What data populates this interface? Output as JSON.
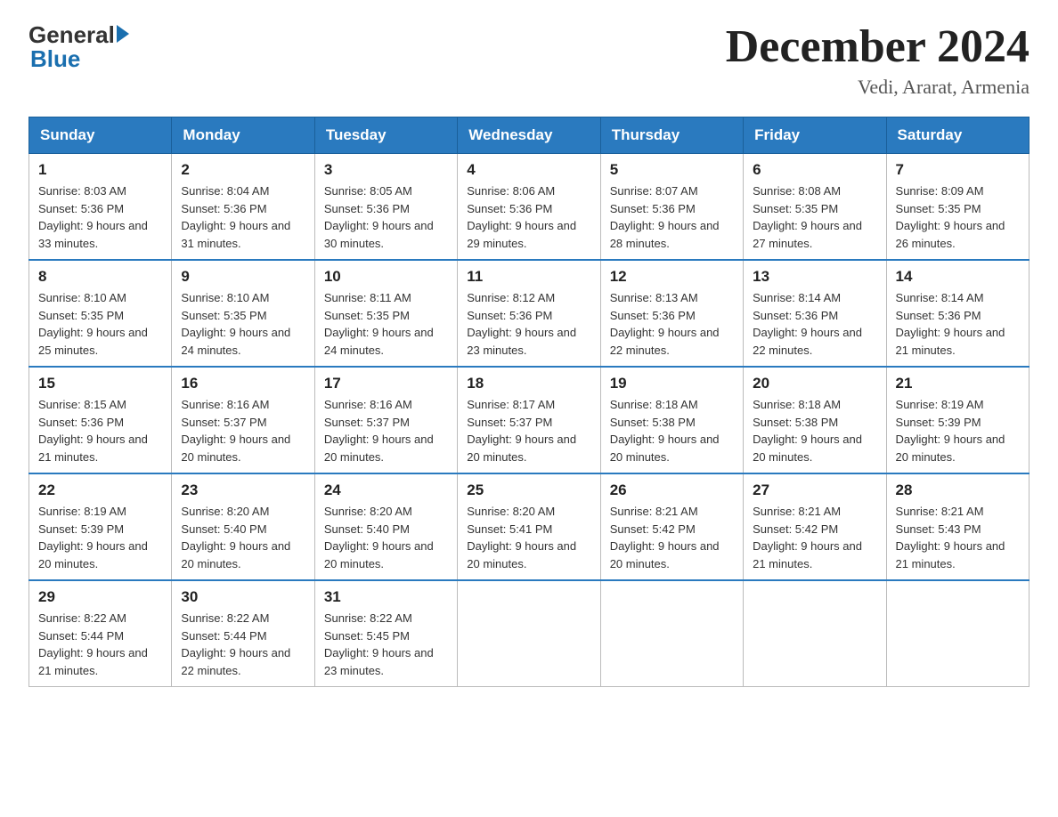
{
  "header": {
    "logo_general": "General",
    "logo_blue": "Blue",
    "title": "December 2024",
    "subtitle": "Vedi, Ararat, Armenia"
  },
  "days_of_week": [
    "Sunday",
    "Monday",
    "Tuesday",
    "Wednesday",
    "Thursday",
    "Friday",
    "Saturday"
  ],
  "weeks": [
    [
      {
        "day": "1",
        "sunrise": "8:03 AM",
        "sunset": "5:36 PM",
        "daylight": "9 hours and 33 minutes."
      },
      {
        "day": "2",
        "sunrise": "8:04 AM",
        "sunset": "5:36 PM",
        "daylight": "9 hours and 31 minutes."
      },
      {
        "day": "3",
        "sunrise": "8:05 AM",
        "sunset": "5:36 PM",
        "daylight": "9 hours and 30 minutes."
      },
      {
        "day": "4",
        "sunrise": "8:06 AM",
        "sunset": "5:36 PM",
        "daylight": "9 hours and 29 minutes."
      },
      {
        "day": "5",
        "sunrise": "8:07 AM",
        "sunset": "5:36 PM",
        "daylight": "9 hours and 28 minutes."
      },
      {
        "day": "6",
        "sunrise": "8:08 AM",
        "sunset": "5:35 PM",
        "daylight": "9 hours and 27 minutes."
      },
      {
        "day": "7",
        "sunrise": "8:09 AM",
        "sunset": "5:35 PM",
        "daylight": "9 hours and 26 minutes."
      }
    ],
    [
      {
        "day": "8",
        "sunrise": "8:10 AM",
        "sunset": "5:35 PM",
        "daylight": "9 hours and 25 minutes."
      },
      {
        "day": "9",
        "sunrise": "8:10 AM",
        "sunset": "5:35 PM",
        "daylight": "9 hours and 24 minutes."
      },
      {
        "day": "10",
        "sunrise": "8:11 AM",
        "sunset": "5:35 PM",
        "daylight": "9 hours and 24 minutes."
      },
      {
        "day": "11",
        "sunrise": "8:12 AM",
        "sunset": "5:36 PM",
        "daylight": "9 hours and 23 minutes."
      },
      {
        "day": "12",
        "sunrise": "8:13 AM",
        "sunset": "5:36 PM",
        "daylight": "9 hours and 22 minutes."
      },
      {
        "day": "13",
        "sunrise": "8:14 AM",
        "sunset": "5:36 PM",
        "daylight": "9 hours and 22 minutes."
      },
      {
        "day": "14",
        "sunrise": "8:14 AM",
        "sunset": "5:36 PM",
        "daylight": "9 hours and 21 minutes."
      }
    ],
    [
      {
        "day": "15",
        "sunrise": "8:15 AM",
        "sunset": "5:36 PM",
        "daylight": "9 hours and 21 minutes."
      },
      {
        "day": "16",
        "sunrise": "8:16 AM",
        "sunset": "5:37 PM",
        "daylight": "9 hours and 20 minutes."
      },
      {
        "day": "17",
        "sunrise": "8:16 AM",
        "sunset": "5:37 PM",
        "daylight": "9 hours and 20 minutes."
      },
      {
        "day": "18",
        "sunrise": "8:17 AM",
        "sunset": "5:37 PM",
        "daylight": "9 hours and 20 minutes."
      },
      {
        "day": "19",
        "sunrise": "8:18 AM",
        "sunset": "5:38 PM",
        "daylight": "9 hours and 20 minutes."
      },
      {
        "day": "20",
        "sunrise": "8:18 AM",
        "sunset": "5:38 PM",
        "daylight": "9 hours and 20 minutes."
      },
      {
        "day": "21",
        "sunrise": "8:19 AM",
        "sunset": "5:39 PM",
        "daylight": "9 hours and 20 minutes."
      }
    ],
    [
      {
        "day": "22",
        "sunrise": "8:19 AM",
        "sunset": "5:39 PM",
        "daylight": "9 hours and 20 minutes."
      },
      {
        "day": "23",
        "sunrise": "8:20 AM",
        "sunset": "5:40 PM",
        "daylight": "9 hours and 20 minutes."
      },
      {
        "day": "24",
        "sunrise": "8:20 AM",
        "sunset": "5:40 PM",
        "daylight": "9 hours and 20 minutes."
      },
      {
        "day": "25",
        "sunrise": "8:20 AM",
        "sunset": "5:41 PM",
        "daylight": "9 hours and 20 minutes."
      },
      {
        "day": "26",
        "sunrise": "8:21 AM",
        "sunset": "5:42 PM",
        "daylight": "9 hours and 20 minutes."
      },
      {
        "day": "27",
        "sunrise": "8:21 AM",
        "sunset": "5:42 PM",
        "daylight": "9 hours and 21 minutes."
      },
      {
        "day": "28",
        "sunrise": "8:21 AM",
        "sunset": "5:43 PM",
        "daylight": "9 hours and 21 minutes."
      }
    ],
    [
      {
        "day": "29",
        "sunrise": "8:22 AM",
        "sunset": "5:44 PM",
        "daylight": "9 hours and 21 minutes."
      },
      {
        "day": "30",
        "sunrise": "8:22 AM",
        "sunset": "5:44 PM",
        "daylight": "9 hours and 22 minutes."
      },
      {
        "day": "31",
        "sunrise": "8:22 AM",
        "sunset": "5:45 PM",
        "daylight": "9 hours and 23 minutes."
      },
      null,
      null,
      null,
      null
    ]
  ],
  "labels": {
    "sunrise_prefix": "Sunrise: ",
    "sunset_prefix": "Sunset: ",
    "daylight_prefix": "Daylight: "
  }
}
